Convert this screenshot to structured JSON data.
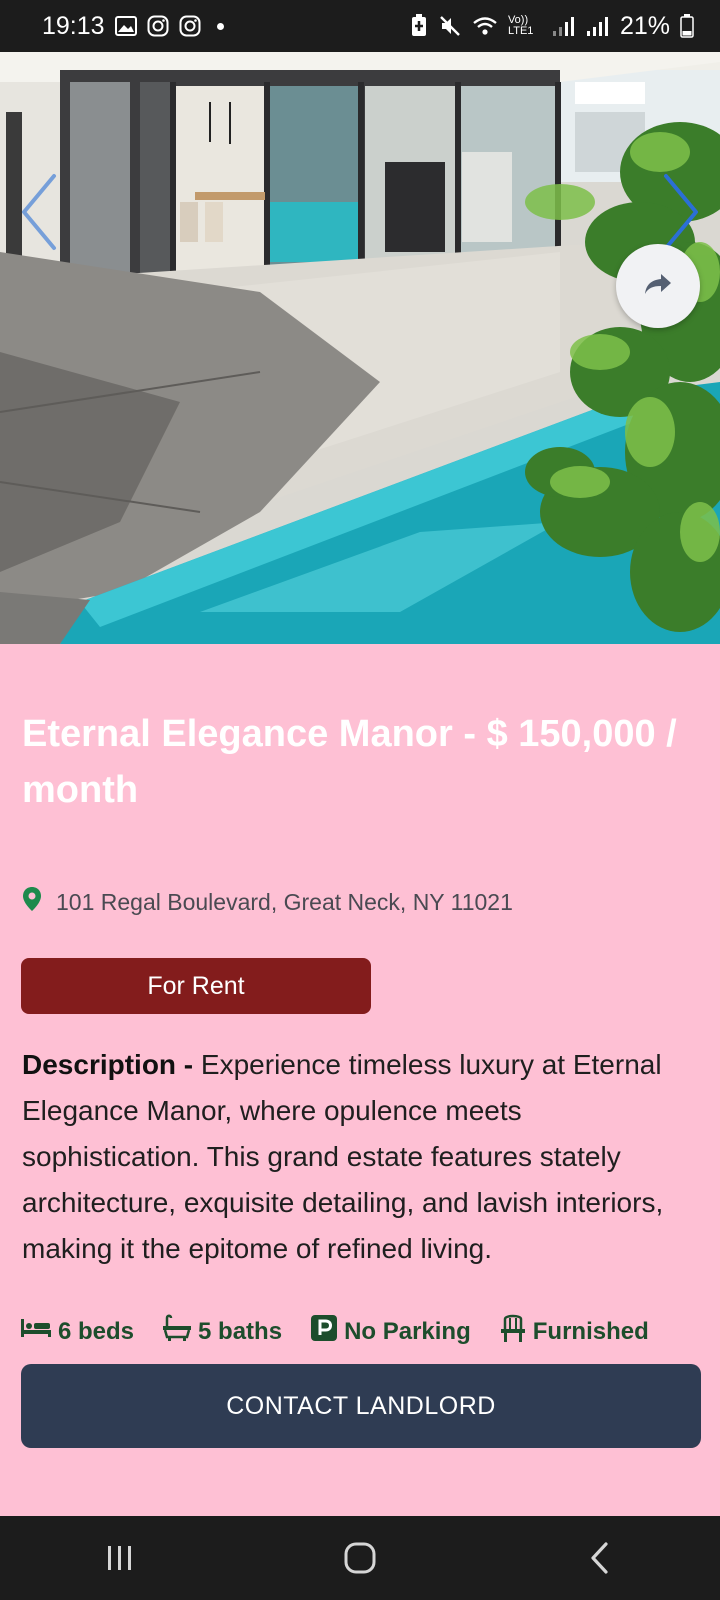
{
  "status_bar": {
    "time": "19:13",
    "battery": "21%",
    "network_label": "Vo)) LTE1",
    "left_icons": [
      "gallery-icon",
      "instagram-icon",
      "instagram-icon",
      "dot-icon"
    ],
    "right_icons": [
      "battery-saver-icon",
      "mute-icon",
      "wifi-icon",
      "signal-icon",
      "signal-icon",
      "battery-icon"
    ]
  },
  "hero": {
    "image_description_icon": "house-pool-photo",
    "prev_icon": "chevron-left-icon",
    "next_icon": "chevron-right-icon",
    "share_icon": "share-icon"
  },
  "listing": {
    "title": "Eternal Elegance Manor - $ 150,000 / month",
    "address": "101 Regal Boulevard, Great Neck, NY 11021",
    "status": "For Rent",
    "description_label": "Description -",
    "description": "Experience timeless luxury at Eternal Elegance Manor, where opulence meets sophistication. This grand estate features stately architecture, exquisite detailing, and lavish interiors, making it the epitome of refined living.",
    "features": [
      {
        "icon": "bed-icon",
        "label": "6 beds"
      },
      {
        "icon": "bathtub-icon",
        "label": "5 baths"
      },
      {
        "icon": "parking-icon",
        "label": "No Parking"
      },
      {
        "icon": "chair-icon",
        "label": "Furnished"
      }
    ],
    "contact_label": "CONTACT LANDLORD"
  },
  "colors": {
    "page_bg": "#fec0d4",
    "badge_bg": "#831c1c",
    "button_bg": "#2f3c53",
    "feature_color": "#1d4d2c",
    "pin_color": "#1e8a4c",
    "arrow_color": "#2b6fd6"
  }
}
